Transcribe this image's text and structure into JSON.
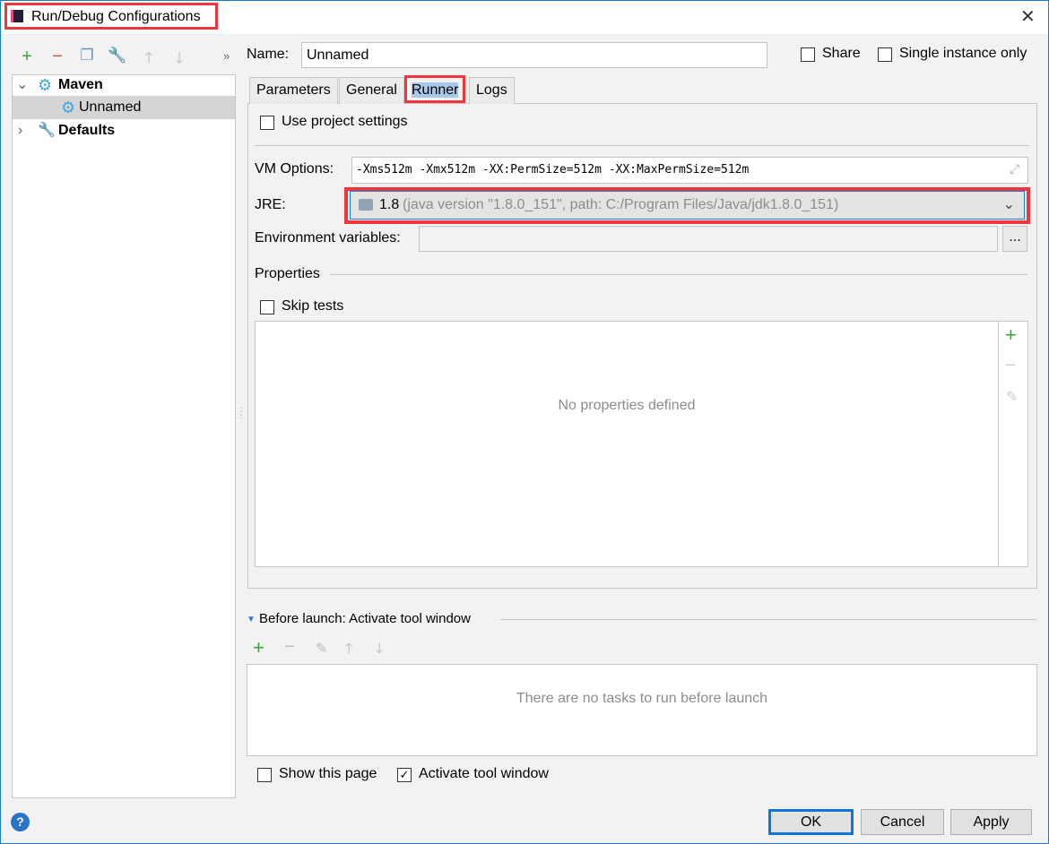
{
  "window": {
    "title": "Run/Debug Configurations",
    "accent": "#1979ca",
    "highlight_color": "#f0363d"
  },
  "toolbar": {
    "icons": [
      "plus-icon",
      "minus-icon",
      "copy-icon",
      "wrench-icon",
      "arrow-up-icon",
      "arrow-down-icon"
    ],
    "more": "»"
  },
  "tree": {
    "items": [
      {
        "label": "Maven",
        "expanded": true
      },
      {
        "label": "Unnamed",
        "selected": true
      },
      {
        "label": "Defaults",
        "expanded": false
      }
    ]
  },
  "name": {
    "label": "Name:",
    "value": "Unnamed"
  },
  "share": {
    "label": "Share",
    "checked": false
  },
  "single_instance": {
    "label": "Single instance only",
    "checked": false
  },
  "tabs": [
    {
      "label": "Parameters"
    },
    {
      "label": "General"
    },
    {
      "label": "Runner",
      "active": true
    },
    {
      "label": "Logs"
    }
  ],
  "runner": {
    "use_project_settings": {
      "label": "Use project settings",
      "checked": false
    },
    "vm_options": {
      "label": "VM Options:",
      "value": "-Xms512m -Xmx512m -XX:PermSize=512m -XX:MaxPermSize=512m"
    },
    "jre": {
      "label": "JRE:",
      "version": "1.8",
      "detail": "(java version \"1.8.0_151\", path: C:/Program Files/Java/jdk1.8.0_151)"
    },
    "env": {
      "label": "Environment variables:",
      "value": "",
      "button": "..."
    },
    "properties": {
      "label": "Properties",
      "empty_text": "No properties defined"
    },
    "skip_tests": {
      "label": "Skip tests",
      "checked": false
    }
  },
  "before_launch": {
    "label": "Before launch: Activate tool window",
    "empty_text": "There are no tasks to run before launch"
  },
  "show_page": {
    "label": "Show this page",
    "checked": false
  },
  "activate_tool_window": {
    "label": "Activate tool window",
    "checked": true
  },
  "buttons": {
    "ok": "OK",
    "cancel": "Cancel",
    "apply": "Apply",
    "help": "?"
  }
}
